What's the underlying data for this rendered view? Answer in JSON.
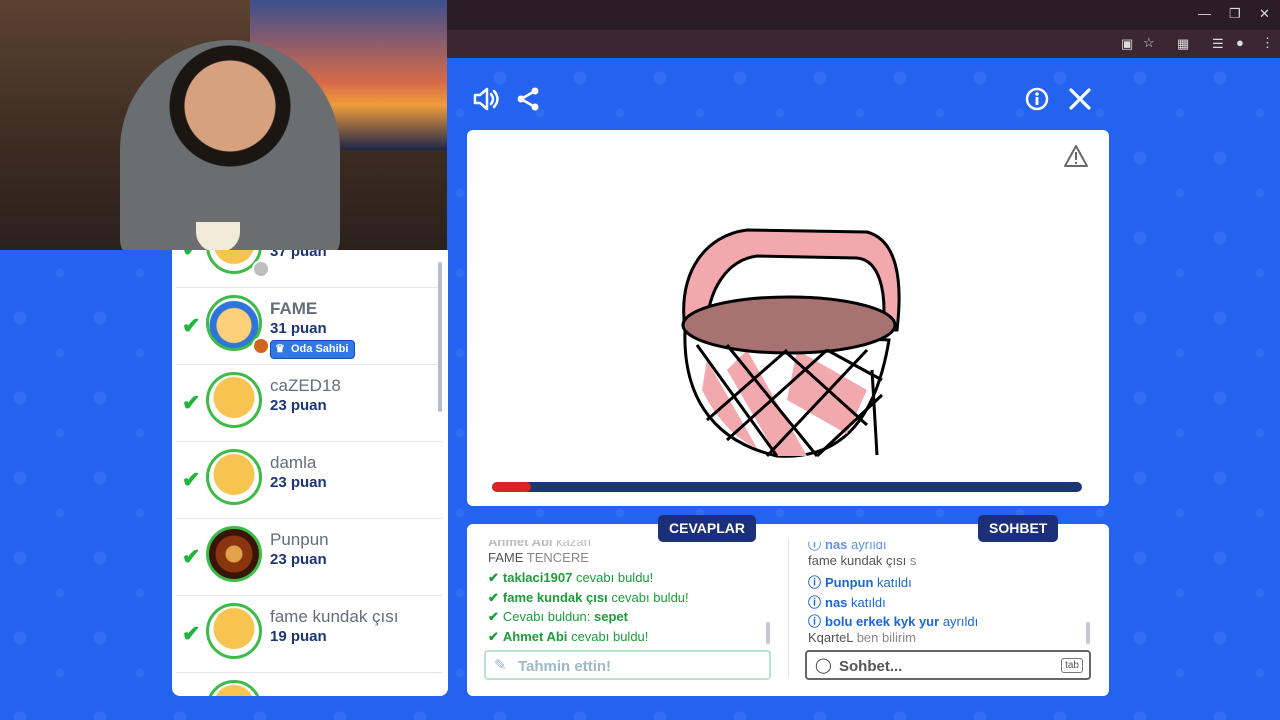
{
  "players": [
    {
      "name": "",
      "score": "37 puan",
      "bold": false
    },
    {
      "name": "FAME",
      "score": "31 puan",
      "badge": "Oda Sahibi",
      "bold": true
    },
    {
      "name": "caZED18",
      "score": "23 puan",
      "bold": false
    },
    {
      "name": "damla",
      "score": "23 puan",
      "bold": false
    },
    {
      "name": "Punpun",
      "score": "23 puan",
      "bold": false
    },
    {
      "name": "fame kundak çısı",
      "score": "19 puan",
      "bold": false
    }
  ],
  "game": {
    "timer_progress": 0.066
  },
  "answers": {
    "tab_label": "CEVAPLAR",
    "messages": [
      {
        "name": "Ahmet Abi",
        "text": "kazan",
        "style": "faded"
      },
      {
        "name": "FAME",
        "text": "TENCERE",
        "style": "grey"
      },
      {
        "name": "taklaci1907",
        "text": "cevabı buldu!",
        "style": "green"
      },
      {
        "name": "fame kundak çısı",
        "text": "cevabı buldu!",
        "style": "green"
      },
      {
        "name": "Cevabı buldun:",
        "text": "sepet",
        "style": "green-answer"
      },
      {
        "name": "Ahmet Abi",
        "text": "cevabı buldu!",
        "style": "green"
      }
    ],
    "input_placeholder": "Tahmin ettin!"
  },
  "chat": {
    "tab_label": "SOHBET",
    "messages": [
      {
        "name": "nas",
        "text": "ayrıldı",
        "style": "blue-faded"
      },
      {
        "name": "fame kundak çısı",
        "text": "s",
        "style": "grey"
      },
      {
        "name": "Punpun",
        "text": "katıldı",
        "style": "blue"
      },
      {
        "name": "nas",
        "text": "katıldı",
        "style": "blue"
      },
      {
        "name": "bolu erkek kyk yur",
        "text": "ayrıldı",
        "style": "blue"
      },
      {
        "name": "KqarteL",
        "text": "ben bilirim",
        "style": "grey"
      }
    ],
    "input_placeholder": "Sohbet...",
    "tab_hint": "tab"
  },
  "colors": {
    "background": "#2463f0",
    "accent_dark": "#1b2f7a",
    "correct_green": "#1e9b3a",
    "progress_red": "#d82424",
    "basket_pink": "#f2a9ad",
    "basket_inner": "#a77272"
  },
  "icons": {
    "sound": "speaker-icon",
    "share": "share-icon",
    "info": "info-icon",
    "close": "close-icon",
    "report": "warning-icon",
    "correct": "checkmark-icon",
    "guess": "pencil-icon",
    "chat": "chat-bubble-icon"
  }
}
